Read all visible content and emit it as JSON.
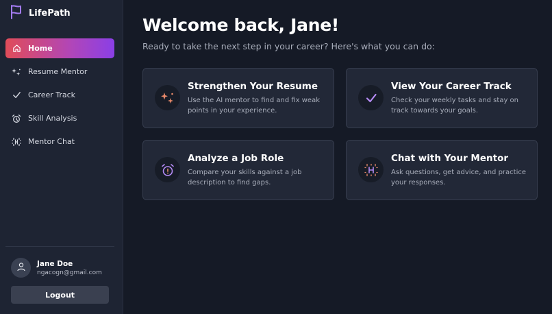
{
  "brand": {
    "name": "LifePath",
    "accent": "#a37bf0"
  },
  "sidebar": {
    "items": [
      {
        "label": "Home",
        "icon": "home-icon",
        "active": true
      },
      {
        "label": "Resume Mentor",
        "icon": "sparkles-icon",
        "active": false
      },
      {
        "label": "Career Track",
        "icon": "check-icon",
        "active": false
      },
      {
        "label": "Skill Analysis",
        "icon": "alarm-icon",
        "active": false
      },
      {
        "label": "Mentor Chat",
        "icon": "chat-icon",
        "active": false
      }
    ]
  },
  "user": {
    "name": "Jane Doe",
    "email": "ngacogn@gmail.com",
    "logout_label": "Logout"
  },
  "main": {
    "title": "Welcome back, Jane!",
    "subtitle": "Ready to take the next step in your career? Here's what you can do:",
    "cards": [
      {
        "title": "Strengthen Your Resume",
        "desc": "Use the AI mentor to find and fix weak points in your experience.",
        "icon": "sparkles-icon"
      },
      {
        "title": "View Your Career Track",
        "desc": "Check your weekly tasks and stay on track towards your goals.",
        "icon": "check-icon"
      },
      {
        "title": "Analyze a Job Role",
        "desc": "Compare your skills against a job description to find gaps.",
        "icon": "alarm-icon"
      },
      {
        "title": "Chat with Your Mentor",
        "desc": "Ask questions, get advice, and practice your responses.",
        "icon": "chat-icon"
      }
    ]
  },
  "colors": {
    "active_gradient_start": "#e04c59",
    "active_gradient_end": "#8a3fe6",
    "icon_orange": "#e8896a",
    "icon_purple": "#b58bf5"
  }
}
